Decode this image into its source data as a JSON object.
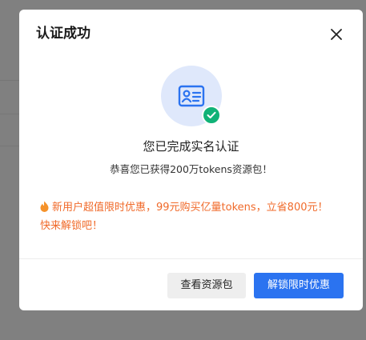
{
  "dialog": {
    "title": "认证成功",
    "success_message": "您已完成实名认证",
    "reward_message": "恭喜您已获得200万tokens资源包！",
    "promo_message": "新用户超值限时优惠，99元购买亿量tokens，立省800元！快来解锁吧！"
  },
  "buttons": {
    "view_package": "查看资源包",
    "unlock_offer": "解锁限时优惠"
  },
  "icons": {
    "close": "close-icon",
    "id_card": "id-card-icon",
    "check": "check-icon",
    "fire": "fire-icon"
  },
  "colors": {
    "primary": "#2b73f0",
    "success": "#10b277",
    "promo": "#f06a2a",
    "hero_bg": "#dfe8fb"
  }
}
